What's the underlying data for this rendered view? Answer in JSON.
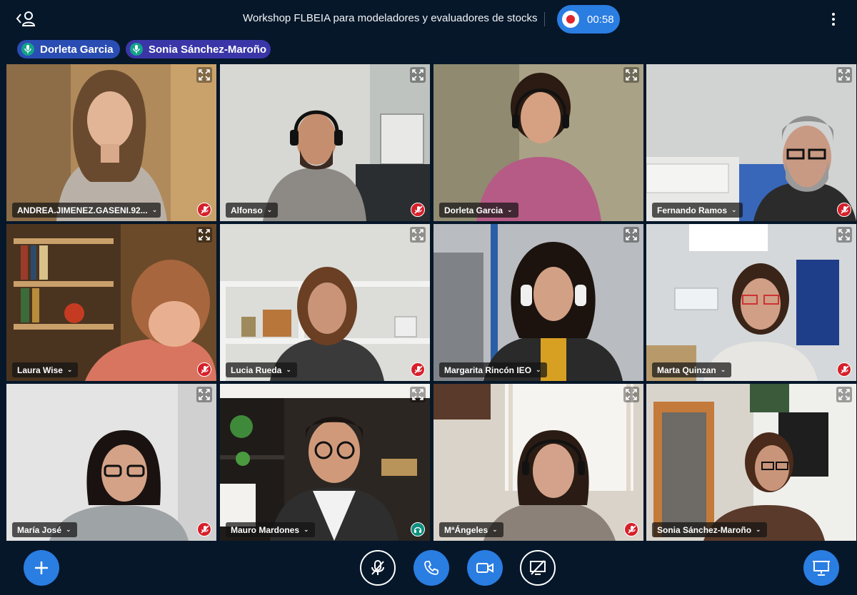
{
  "header": {
    "title": "Workshop FLBEIA para modeladores y evaluadores de stocks",
    "recording_time": "00:58",
    "icons": {
      "users_toggle": "user-list-icon",
      "record": "record-icon",
      "options": "more-vertical-icon"
    }
  },
  "talking": [
    {
      "name": "Dorleta Garcia",
      "icon": "microphone-icon"
    },
    {
      "name": "Sonia Sánchez-Maroño",
      "icon": "microphone-icon"
    }
  ],
  "participants": [
    {
      "name": "ANDREA.JIMENEZ.GASENI.92...",
      "status": "muted",
      "active": false
    },
    {
      "name": "Alfonso",
      "status": "muted",
      "active": false
    },
    {
      "name": "Dorleta Garcia",
      "status": "none",
      "active": true
    },
    {
      "name": "Fernando Ramos",
      "status": "muted",
      "active": false
    },
    {
      "name": "Laura Wise",
      "status": "muted",
      "active": false
    },
    {
      "name": "Lucia Rueda",
      "status": "muted",
      "active": false
    },
    {
      "name": "Margarita Rincón IEO",
      "status": "none",
      "active": false
    },
    {
      "name": "Marta Quinzan",
      "status": "muted",
      "active": false
    },
    {
      "name": "María José",
      "status": "muted",
      "active": false
    },
    {
      "name": "Mauro Mardones",
      "status": "listen-only",
      "active": false
    },
    {
      "name": "MªÁngeles",
      "status": "muted",
      "active": false
    },
    {
      "name": "Sonia Sánchez-Maroño",
      "status": "none",
      "active": true
    }
  ],
  "controls": {
    "actions": "plus-icon",
    "mute": "microphone-off-icon",
    "audio": "phone-icon",
    "video": "video-camera-icon",
    "screenshare": "screenshare-off-icon",
    "presentation": "presentation-icon"
  },
  "colors": {
    "background": "#06172a",
    "accent": "#2a7de1",
    "recording": "#e0262d",
    "muted": "#d6202b",
    "talking_mic": "#14a38a"
  }
}
